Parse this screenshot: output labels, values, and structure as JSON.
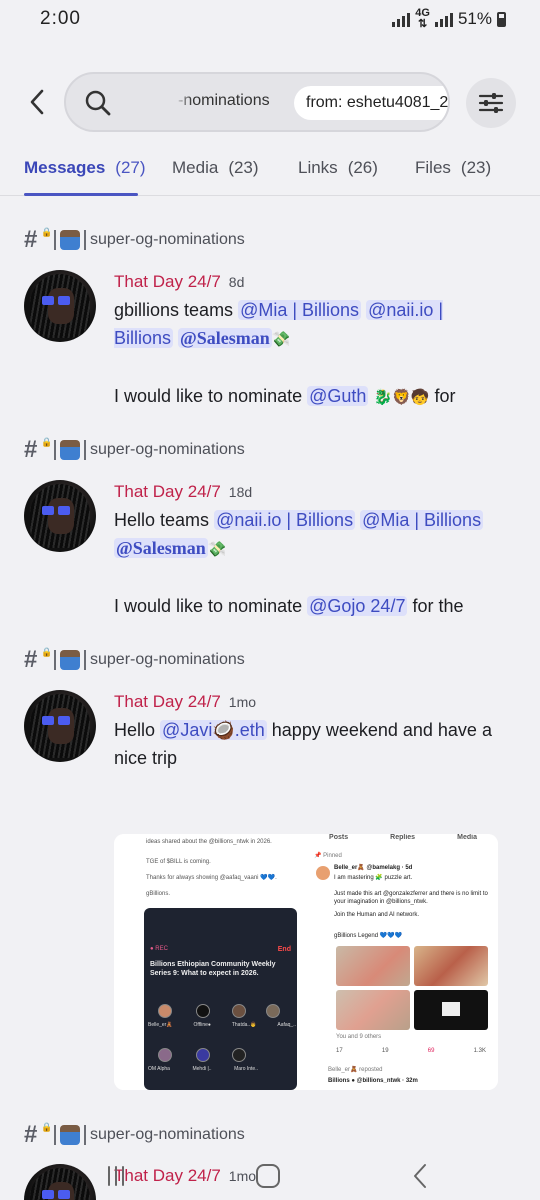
{
  "status_bar": {
    "time": "2:00",
    "network": "4G",
    "battery": "51%"
  },
  "search": {
    "partial_chip": "-nominations",
    "from_chip": "from: eshetu4081_25715"
  },
  "tabs": [
    {
      "label": "Messages",
      "count": "(27)"
    },
    {
      "label": "Media",
      "count": "(23)"
    },
    {
      "label": "Links",
      "count": "(26)"
    },
    {
      "label": "Files",
      "count": "(23)"
    }
  ],
  "channel_name": "super-og-nominations",
  "messages": [
    {
      "author": "That Day 24/7",
      "time": "8d",
      "line1_prefix": "gbillions teams",
      "m1": "@Mia | Billions",
      "m2": "@naii.io | Billions",
      "m3": "@Salesman",
      "line3_prefix": "I would like to nominate",
      "m4": "@Guth",
      "line3_suffix": "for"
    },
    {
      "author": "That Day 24/7",
      "time": "18d",
      "line1_prefix": "Hello teams",
      "m1": "@naii.io | Billions",
      "m2": "@Mia | Billions",
      "m3": "@Salesman",
      "line3_prefix": "I would like to nominate",
      "m4": "@Gojo 24/7",
      "line3_suffix": "for the"
    },
    {
      "author": "That Day 24/7",
      "time": "1mo",
      "prefix": "Hello",
      "m1": "@Javi🥥.eth",
      "suffix": "happy weekend and have a nice trip"
    },
    {
      "author": "That Day 24/7",
      "time": "1mo"
    }
  ],
  "attachment": {
    "left_top_text": "ideas shared about the @billions_ntwk in 2026.",
    "tge_text": "TGE of $BILL is coming.",
    "thanks_text": "Thanks for always showing @aafaq_vaani 💙💙.",
    "sign_text": "gBillions.",
    "live_text": "● REC",
    "card_title": "Billions Ethiopian Community Weekly Series 9: What to expect in 2026.",
    "end_text": "End",
    "host_names": [
      "Belle_er🧸",
      "Offline●",
      "Thatda..👨",
      "Aafaq_..",
      "OM Alpha",
      "Mehdi |..",
      "Maro Inte.."
    ],
    "right_tabs": [
      "Posts",
      "Replies",
      "Media"
    ],
    "pinned_text": "Pinned",
    "post_author": "Belle_er🧸 @bamelakg · 5d",
    "post_text1": "I am mastering 🧩 puzzle art.",
    "post_text2": "Just made this art @gonzalezferrer and there is no limit to your imagination in @billions_ntwk.",
    "post_text3": "Join the Human and AI network.",
    "post_text4": "gBillions Legend 💙💙💙",
    "you_and_others": "You and 9 others",
    "stats": [
      "17",
      "19",
      "69",
      "1.3K"
    ],
    "repost_text": "Belle_er🧸 reposted",
    "repost_author": "Billions ● @billions_ntwk · 32m"
  },
  "colors": {
    "accent": "#4a55c2",
    "author": "#c0224a",
    "mention_bg": "#dde0fa",
    "background": "#f1f1f4"
  },
  "icons": [
    "back-arrow-icon",
    "search-icon",
    "filter-sliders-icon",
    "hash-lock-icon",
    "recent-apps-icon",
    "home-icon",
    "back-icon"
  ]
}
